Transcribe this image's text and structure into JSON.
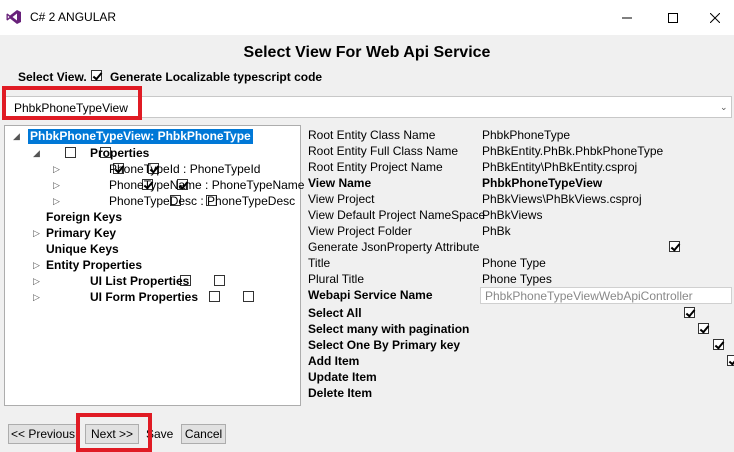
{
  "window": {
    "title": "C# 2 ANGULAR"
  },
  "header": {
    "title": "Select View For Web Api Service"
  },
  "options": {
    "select_view_label": "Select View.",
    "generate_localizable_label": "Generate Localizable typescript code",
    "generate_localizable_checked": true
  },
  "view_combo": {
    "selected": "PhbkPhoneTypeView"
  },
  "tree": {
    "root": "PhbkPhoneTypeView: PhbkPhoneType",
    "properties": "Properties",
    "prop1": "PhoneTypeId : PhoneTypeId",
    "prop2": "PhoneTypeName : PhoneTypeName",
    "prop3": "PhoneTypeDesc : PhoneTypeDesc",
    "foreign_keys": "Foreign Keys",
    "primary_key": "Primary Key",
    "unique_keys": "Unique Keys",
    "entity_properties": "Entity Properties",
    "ui_list": "UI List Properties",
    "ui_form": "UI Form Properties"
  },
  "grid": {
    "rows": [
      {
        "key": "Root Entity Class Name",
        "value": "PhbkPhoneType"
      },
      {
        "key": "Root Entity Full Class Name",
        "value": "PhBkEntity.PhBk.PhbkPhoneType"
      },
      {
        "key": "Root Entity Project Name",
        "value": "PhBkEntity\\PhBkEntity.csproj"
      },
      {
        "key": "View Name",
        "value": "PhbkPhoneTypeView"
      },
      {
        "key": "View Project",
        "value": "PhBkViews\\PhBkViews.csproj"
      },
      {
        "key": "View Default Project NameSpace",
        "value": "PhBkViews"
      },
      {
        "key": "View Project Folder",
        "value": "PhBk"
      },
      {
        "key": "Generate JsonProperty Attribute",
        "value": ""
      },
      {
        "key": "Title",
        "value": "Phone Type"
      },
      {
        "key": "Plural Title",
        "value": "Phone Types"
      },
      {
        "key": "Webapi Service Name",
        "value": "PhbkPhoneTypeViewWebApiController"
      },
      {
        "key": "Select All",
        "value": ""
      },
      {
        "key": "Select many with pagination",
        "value": ""
      },
      {
        "key": "Select One By Primary key",
        "value": ""
      },
      {
        "key": "Add Item",
        "value": ""
      },
      {
        "key": "Update Item",
        "value": ""
      },
      {
        "key": "Delete Item",
        "value": ""
      }
    ]
  },
  "buttons": {
    "previous": "<< Previous",
    "next": "Next >>",
    "save": "Save",
    "cancel": "Cancel"
  }
}
